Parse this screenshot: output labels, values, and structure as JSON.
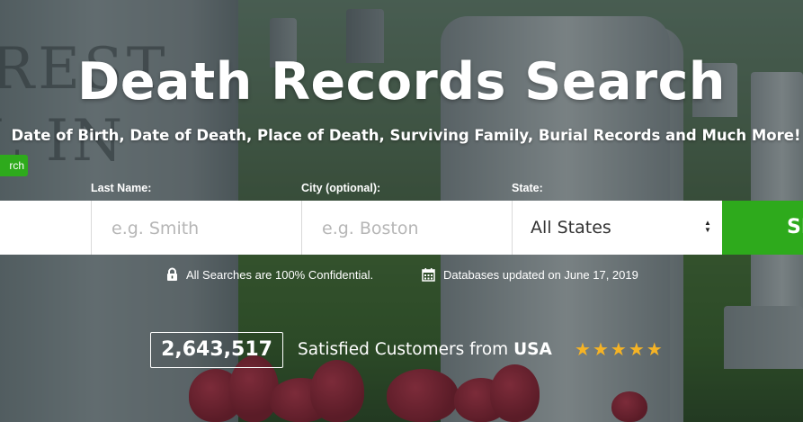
{
  "hero": {
    "title": "Death Records Search",
    "subtitle": "Date of Birth, Date of Death, Place of Death, Surviving Family, Burial Records and Much More!"
  },
  "tab_pill": {
    "label": "rch"
  },
  "form": {
    "last_name": {
      "label": "Last Name:",
      "placeholder": "e.g. Smith",
      "value": ""
    },
    "city": {
      "label": "City (optional):",
      "placeholder": "e.g. Boston",
      "value": ""
    },
    "state": {
      "label": "State:",
      "selected": "All States"
    },
    "submit_label": "SE"
  },
  "info": {
    "confidential": "All Searches are 100% Confidential.",
    "updated": "Databases updated on June 17, 2019"
  },
  "social_proof": {
    "count": "2,643,517",
    "text": "Satisfied Customers from",
    "country": "USA",
    "rating_stars": 5
  },
  "colors": {
    "accent": "#2eaa1c",
    "star": "#f5b325"
  }
}
